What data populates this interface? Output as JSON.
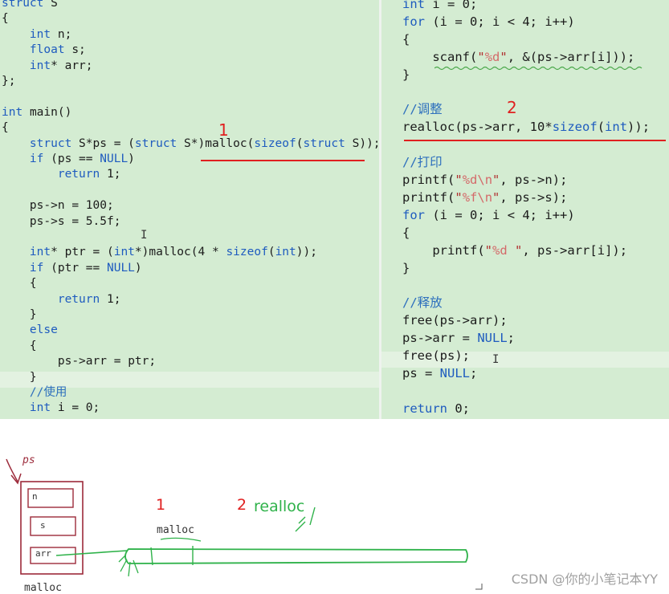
{
  "left_code": [
    {
      "text": "struct S"
    },
    {
      "text": "{"
    },
    {
      "text": "    int n;"
    },
    {
      "text": "    float s;"
    },
    {
      "text": "    int* arr;"
    },
    {
      "text": "};"
    },
    {
      "text": ""
    },
    {
      "text": "int main()"
    },
    {
      "text": "{"
    },
    {
      "text": "    struct S*ps = (struct S*)malloc(sizeof(struct S));"
    },
    {
      "text": "    if (ps == NULL)"
    },
    {
      "text": "        return 1;"
    },
    {
      "text": ""
    },
    {
      "text": "    ps->n = 100;"
    },
    {
      "text": "    ps->s = 5.5f;"
    },
    {
      "text": ""
    },
    {
      "text": "    int* ptr = (int*)malloc(4 * sizeof(int));"
    },
    {
      "text": "    if (ptr == NULL)"
    },
    {
      "text": "    {"
    },
    {
      "text": "        return 1;"
    },
    {
      "text": "    }"
    },
    {
      "text": "    else"
    },
    {
      "text": "    {"
    },
    {
      "text": "        ps->arr = ptr;"
    },
    {
      "text": "    }"
    },
    {
      "text": "    //使用"
    },
    {
      "text": "    int i = 0;"
    }
  ],
  "right_code": [
    {
      "text": "int i = 0;"
    },
    {
      "text": "for (i = 0; i < 4; i++)"
    },
    {
      "text": "{"
    },
    {
      "text": "    scanf(\"%d\", &(ps->arr[i]));"
    },
    {
      "text": "}"
    },
    {
      "text": ""
    },
    {
      "text": "//调整"
    },
    {
      "text": "realloc(ps->arr, 10*sizeof(int));"
    },
    {
      "text": ""
    },
    {
      "text": "//打印"
    },
    {
      "text": "printf(\"%d\\n\", ps->n);"
    },
    {
      "text": "printf(\"%f\\n\", ps->s);"
    },
    {
      "text": "for (i = 0; i < 4; i++)"
    },
    {
      "text": "{"
    },
    {
      "text": "    printf(\"%d \", ps->arr[i]);"
    },
    {
      "text": "}"
    },
    {
      "text": ""
    },
    {
      "text": "//释放"
    },
    {
      "text": "free(ps->arr);"
    },
    {
      "text": "ps->arr = NULL;"
    },
    {
      "text": "free(ps);"
    },
    {
      "text": "ps = NULL;"
    },
    {
      "text": ""
    },
    {
      "text": "return 0;"
    }
  ],
  "annotations": {
    "mark1_left": "1",
    "mark2_right": "2",
    "sketch_num1": "1",
    "sketch_num2": "2",
    "sketch_realloc": "realloc"
  },
  "sketch": {
    "ps_label": "ps",
    "field_n": "n",
    "field_s": "s",
    "field_arr": "arr",
    "malloc_below": "malloc",
    "malloc_above": "malloc"
  },
  "watermark": "CSDN @你的小笔记本YY",
  "colors": {
    "panel_bg": "#d4ecd2",
    "keyword": "#1e5bbf",
    "string": "#b03030",
    "red_mark": "#e02020",
    "green_pen": "#2fb24a",
    "box_red": "#9c2a3a"
  }
}
